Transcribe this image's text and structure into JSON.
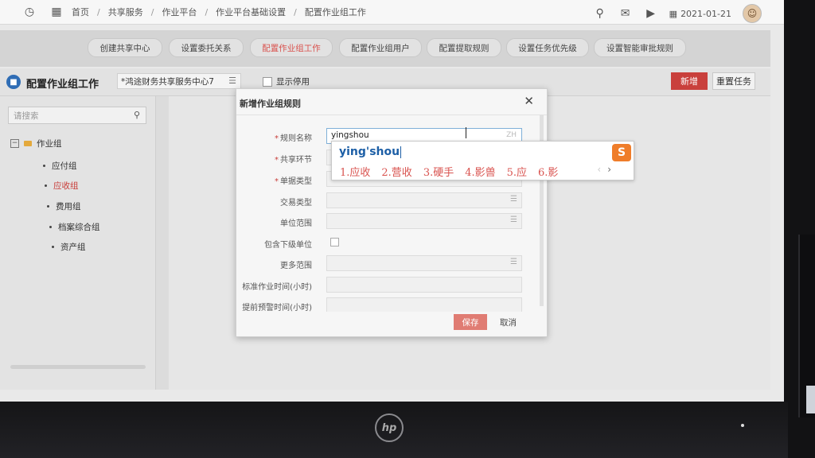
{
  "breadcrumb": [
    "首页",
    "共享服务",
    "作业平台",
    "作业平台基础设置",
    "配置作业组工作"
  ],
  "topbar": {
    "date": "2021-01-21"
  },
  "tabs": [
    {
      "label": "创建共享中心",
      "active": false
    },
    {
      "label": "设置委托关系",
      "active": false
    },
    {
      "label": "配置作业组工作",
      "active": true
    },
    {
      "label": "配置作业组用户",
      "active": false
    },
    {
      "label": "配置提取规则",
      "active": false
    },
    {
      "label": "设置任务优先级",
      "active": false
    },
    {
      "label": "设置智能审批规则",
      "active": false
    }
  ],
  "page": {
    "title": "配置作业组工作",
    "center_select": "*鸿途财务共享服务中心7",
    "show_disabled": "显示停用",
    "new_button": "新增",
    "reassign_button": "重置任务"
  },
  "sidebar": {
    "search_placeholder": "请搜索",
    "root": "作业组",
    "items": [
      {
        "label": "应付组",
        "selected": false
      },
      {
        "label": "应收组",
        "selected": true
      },
      {
        "label": "费用组",
        "selected": false
      },
      {
        "label": "档案综合组",
        "selected": false
      },
      {
        "label": "资产组",
        "selected": false
      }
    ]
  },
  "dialog": {
    "title": "新增作业组规则",
    "fields": [
      {
        "label": "规则名称",
        "required": true,
        "value": "yingshou",
        "hint": "ZH"
      },
      {
        "label": "共享环节",
        "required": true,
        "value": ""
      },
      {
        "label": "单据类型",
        "required": true,
        "value": ""
      },
      {
        "label": "交易类型",
        "required": false,
        "value": ""
      },
      {
        "label": "单位范围",
        "required": false,
        "value": ""
      },
      {
        "label": "包含下级单位",
        "required": false,
        "type": "checkbox"
      },
      {
        "label": "更多范围",
        "required": false,
        "value": ""
      },
      {
        "label": "标准作业时间(小时)",
        "required": false,
        "value": ""
      },
      {
        "label": "提前预警时间(小时)",
        "required": false,
        "value": ""
      }
    ],
    "save": "保存",
    "cancel": "取消"
  },
  "ime": {
    "composition": "ying'shou",
    "candidates": [
      "1.应收",
      "2.营收",
      "3.硬手",
      "4.影兽",
      "5.应",
      "6.影"
    ],
    "logo": "S"
  },
  "colors": {
    "accent": "#c9403c",
    "ime_text": "#d9534f",
    "ime_logo": "#ef7d2a"
  }
}
